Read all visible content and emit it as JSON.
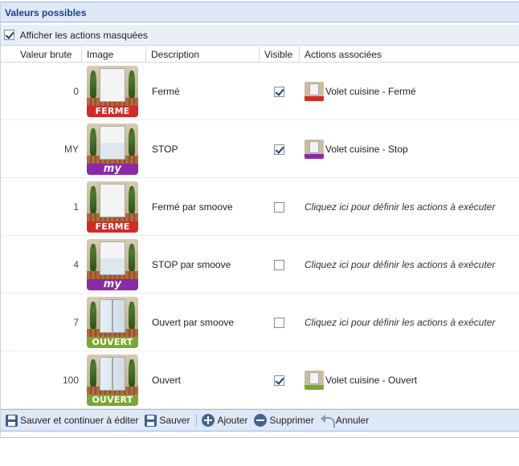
{
  "panel": {
    "title": "Valeurs possibles",
    "show_hidden_label": "Afficher les actions masquées",
    "show_hidden_checked": true
  },
  "columns": [
    "Valeur brute",
    "Image",
    "Description",
    "Visible",
    "Actions associées"
  ],
  "rows": [
    {
      "raw": "0",
      "image_badge": "FERME",
      "image_state": "closed",
      "badge_color": "#d32a27",
      "description": "Fermé",
      "visible": true,
      "action_text": "Volet cuisine - Fermé",
      "action_is_link": false
    },
    {
      "raw": "MY",
      "image_badge": "my",
      "image_state": "half",
      "badge_color": "#8a2aa6",
      "description": "STOP",
      "visible": true,
      "action_text": "Volet cuisine - Stop",
      "action_is_link": false
    },
    {
      "raw": "1",
      "image_badge": "FERME",
      "image_state": "closed",
      "badge_color": "#d32a27",
      "description": "Fermé par smoove",
      "visible": false,
      "action_text": "Cliquez ici pour définir les actions à exécuter",
      "action_is_link": true
    },
    {
      "raw": "4",
      "image_badge": "my",
      "image_state": "half",
      "badge_color": "#8a2aa6",
      "description": "STOP par smoove",
      "visible": false,
      "action_text": "Cliquez ici pour définir les actions à exécuter",
      "action_is_link": true
    },
    {
      "raw": "7",
      "image_badge": "OUVERT",
      "image_state": "open",
      "badge_color": "#7aa82f",
      "description": "Ouvert par smoove",
      "visible": false,
      "action_text": "Cliquez ici pour définir les actions à exécuter",
      "action_is_link": true
    },
    {
      "raw": "100",
      "image_badge": "OUVERT",
      "image_state": "open",
      "badge_color": "#7aa82f",
      "description": "Ouvert",
      "visible": true,
      "action_text": "Volet cuisine - Ouvert",
      "action_is_link": false
    }
  ],
  "toolbar": {
    "save_continue_label": "Sauver et continuer à éditer",
    "save_label": "Sauver",
    "add_label": "Ajouter",
    "delete_label": "Supprimer",
    "cancel_label": "Annuler"
  },
  "icons": {
    "save": "floppy-disk-icon",
    "add": "plus-circle-icon",
    "delete": "minus-circle-icon",
    "cancel": "undo-icon"
  },
  "colors": {
    "header_bg": "#dfe8f6",
    "header_text": "#15428b",
    "badge_red": "#d32a27",
    "badge_purple": "#8a2aa6",
    "badge_green": "#7aa82f"
  }
}
